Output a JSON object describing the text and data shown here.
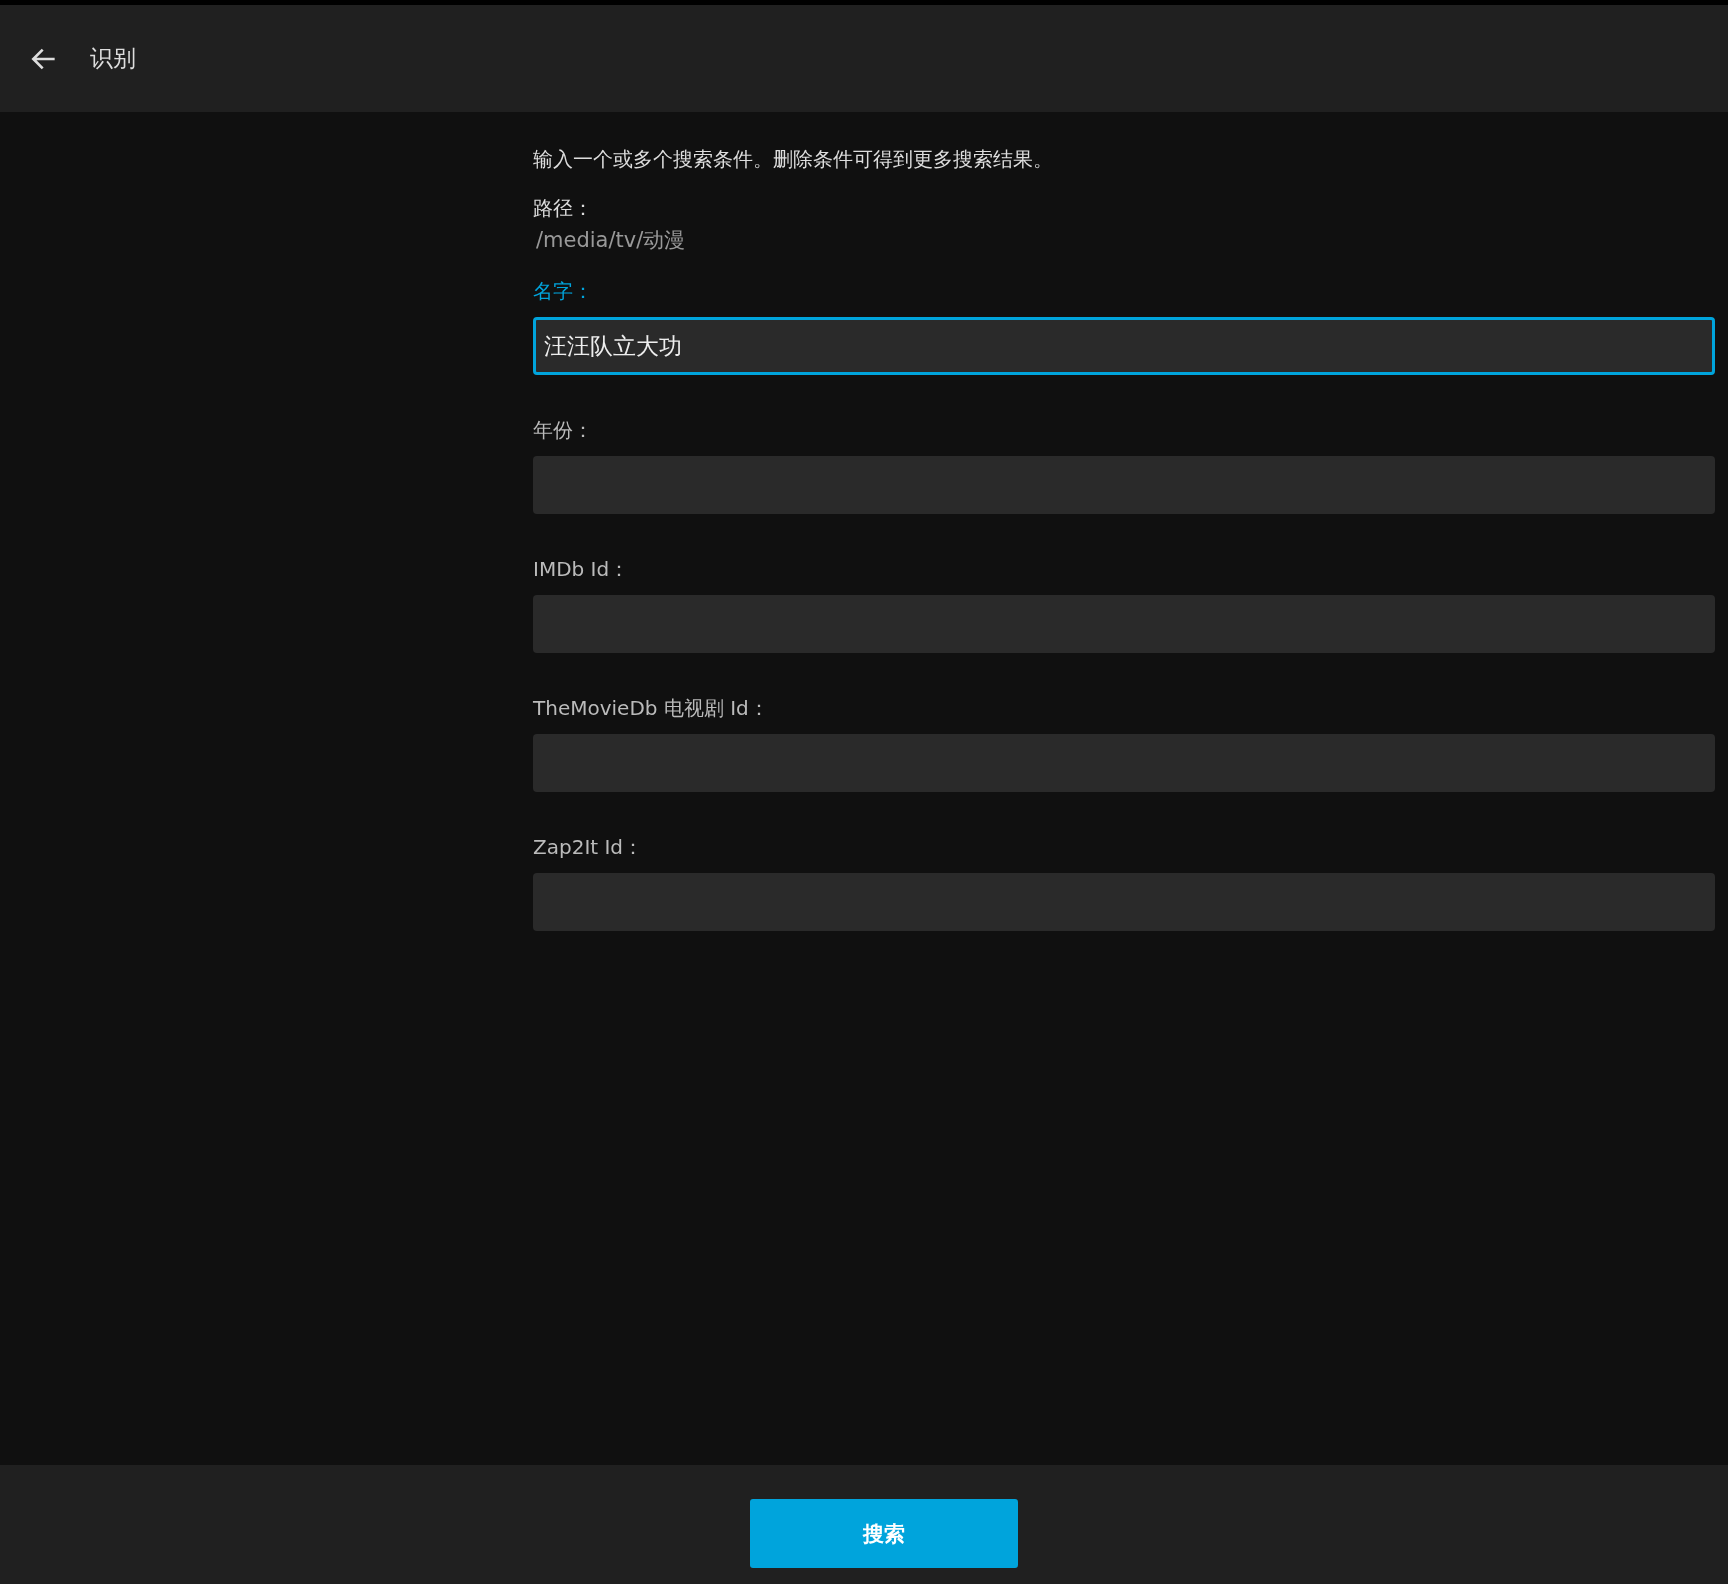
{
  "header": {
    "title": "识别"
  },
  "intro": "输入一个或多个搜索条件。删除条件可得到更多搜索结果。",
  "path": {
    "label": "路径：",
    "value": "/media/tv/动漫"
  },
  "fields": [
    {
      "label": "名字：",
      "value": "汪汪队立大功",
      "focused": true
    },
    {
      "label": "年份：",
      "focused": false
    },
    {
      "label": "IMDb Id：",
      "focused": false
    },
    {
      "label": "TheMovieDb 电视剧 Id：",
      "focused": false
    },
    {
      "label": "Zap2It Id：",
      "focused": false
    }
  ],
  "footer": {
    "button": "搜索"
  }
}
